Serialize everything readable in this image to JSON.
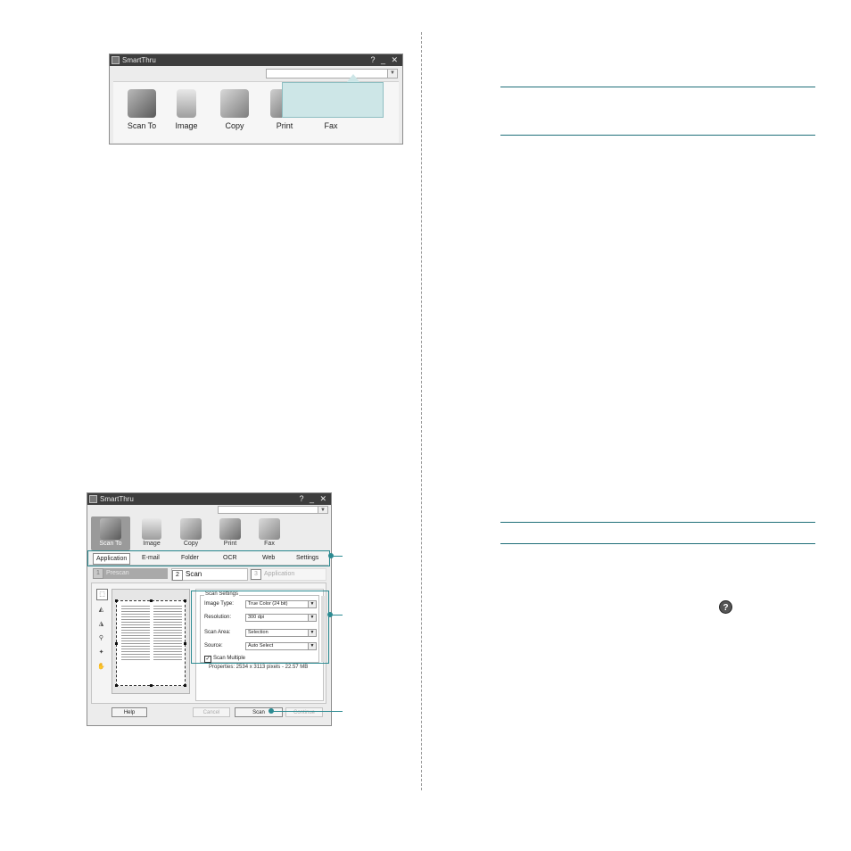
{
  "window_top": {
    "title": "SmartThru",
    "controls": "? _ ✕",
    "tools": [
      {
        "label": "Scan To",
        "icon": "scanner-icon"
      },
      {
        "label": "Image",
        "icon": "image-icon"
      },
      {
        "label": "Copy",
        "icon": "copier-icon"
      },
      {
        "label": "Print",
        "icon": "printer-icon"
      },
      {
        "label": "Fax",
        "icon": "fax-icon"
      }
    ]
  },
  "window_main": {
    "title": "SmartThru",
    "controls": "? _ ✕",
    "tools": [
      {
        "label": "Scan To",
        "icon": "scanner-icon"
      },
      {
        "label": "Image",
        "icon": "image-icon"
      },
      {
        "label": "Copy",
        "icon": "copier-icon"
      },
      {
        "label": "Print",
        "icon": "printer-icon"
      },
      {
        "label": "Fax",
        "icon": "fax-icon"
      }
    ],
    "tabs": [
      "Application",
      "E-mail",
      "Folder",
      "OCR",
      "Web",
      "Settings"
    ],
    "steps": [
      {
        "num": "1",
        "label": "Prescan"
      },
      {
        "num": "2",
        "label": "Scan"
      },
      {
        "num": "3",
        "label": "Application"
      }
    ],
    "scan_settings": {
      "legend": "Scan Settings",
      "fields": [
        {
          "label": "Image Type:",
          "value": "True Color (24 bit)"
        },
        {
          "label": "Resolution:",
          "value": "300 dpi"
        },
        {
          "label": "Scan Area:",
          "value": "Selection"
        },
        {
          "label": "Source:",
          "value": "Auto Select"
        }
      ],
      "scan_multiple_label": "Scan Multiple",
      "scan_multiple_checked": true,
      "properties": "Properties: 2534 x 3113 pixels - 22.57 MB"
    },
    "buttons": {
      "help": "Help",
      "cancel": "Cancel",
      "scan": "Scan",
      "continue": "Continue"
    }
  },
  "colors": {
    "callout": "#2b8a91",
    "tooltip_fill": "#cde6e7",
    "rule": "#1f6f79"
  }
}
